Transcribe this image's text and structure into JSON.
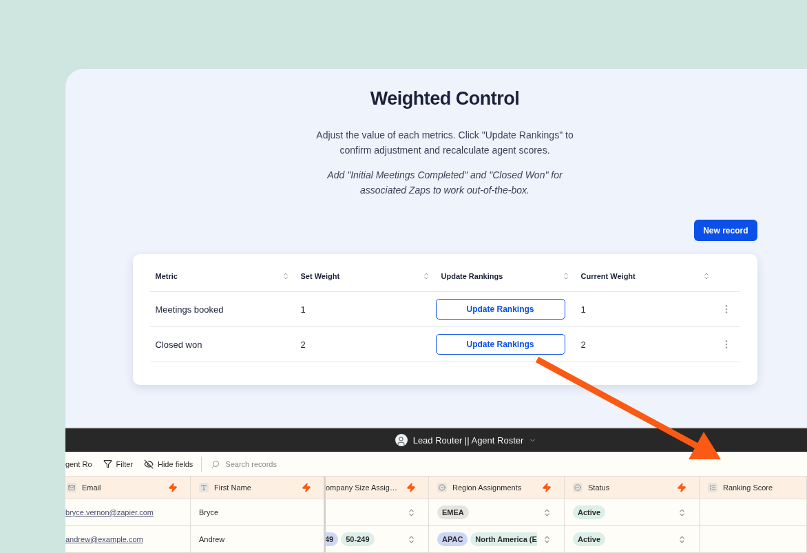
{
  "card": {
    "title": "Weighted Control",
    "description": "Adjust the value of each metrics. Click \"Update Rankings\" to confirm adjustment and recalculate agent scores.",
    "note": "Add \"Initial Meetings Completed\" and \"Closed Won\" for associated Zaps to work out-of-the-box.",
    "new_button": "New record",
    "table": {
      "columns": [
        "Metric",
        "Set Weight",
        "Update Rankings",
        "Current Weight"
      ],
      "rows": [
        {
          "metric": "Meetings booked",
          "set_weight": "1",
          "button": "Update Rankings",
          "current_weight": "1"
        },
        {
          "metric": "Closed won",
          "set_weight": "2",
          "button": "Update Rankings",
          "current_weight": "2"
        }
      ]
    }
  },
  "app": {
    "title": "Lead Router || Agent Roster",
    "toolbar": {
      "view": "gent Ro",
      "filter": "Filter",
      "hide_fields": "Hide fields",
      "search_placeholder": "Search records"
    },
    "grid": {
      "columns": [
        {
          "label": "Email",
          "kind": "email",
          "automated": true
        },
        {
          "label": "First Name",
          "kind": "text",
          "automated": true
        },
        {
          "label": "ompany Size Assig…",
          "automated": true
        },
        {
          "label": "Region Assignments",
          "kind": "select",
          "automated": true
        },
        {
          "label": "Status",
          "kind": "select",
          "automated": true
        },
        {
          "label": "Ranking Score",
          "kind": "number",
          "automated": false
        }
      ],
      "rows": [
        {
          "cells": [
            {
              "kind": "link",
              "text": "bryce.vernon@zapier.com"
            },
            {
              "kind": "text",
              "text": "Bryce"
            },
            {
              "kind": "select"
            },
            {
              "kind": "select",
              "tags": [
                {
                  "text": "EMEA",
                  "color": "#e6e4e1"
                }
              ]
            },
            {
              "kind": "select",
              "tags": [
                {
                  "text": "Active",
                  "color": "#dcefe8"
                }
              ]
            },
            {
              "kind": "empty"
            }
          ]
        },
        {
          "cells": [
            {
              "kind": "link",
              "text": "andrew@example.com"
            },
            {
              "kind": "text",
              "text": "Andrew"
            },
            {
              "kind": "select",
              "tags": [
                {
                  "text": "49",
                  "color": "#cdd6f5"
                },
                {
                  "text": "50-249",
                  "color": "#dcefe8"
                }
              ]
            },
            {
              "kind": "select",
              "tags": [
                {
                  "text": "APAC",
                  "color": "#cdd6f5"
                },
                {
                  "text": "North America (E",
                  "color": "#dcefe8"
                }
              ]
            },
            {
              "kind": "select",
              "tags": [
                {
                  "text": "Active",
                  "color": "#dcefe8"
                }
              ]
            },
            {
              "kind": "empty"
            }
          ]
        }
      ]
    }
  }
}
